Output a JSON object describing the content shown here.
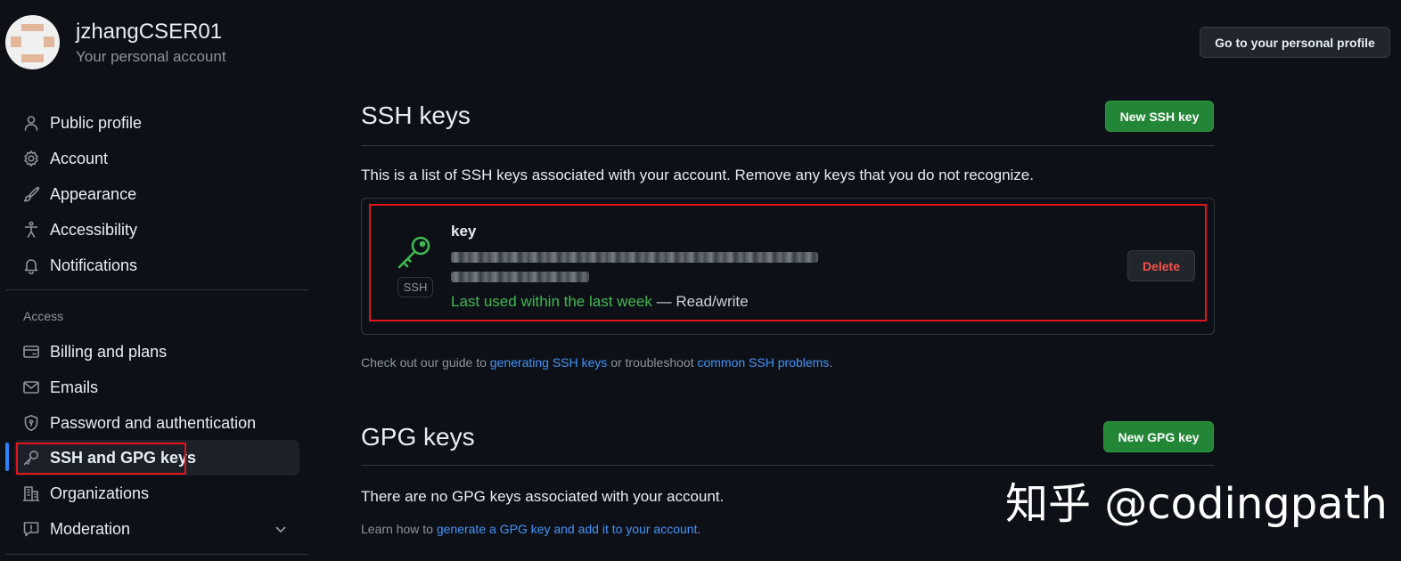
{
  "header": {
    "username": "jzhangCSER01",
    "account_type": "Your personal account",
    "profile_button": "Go to your personal profile"
  },
  "sidebar": {
    "items": [
      {
        "label": "Public profile",
        "icon": "person-icon"
      },
      {
        "label": "Account",
        "icon": "gear-icon"
      },
      {
        "label": "Appearance",
        "icon": "paintbrush-icon"
      },
      {
        "label": "Accessibility",
        "icon": "accessibility-icon"
      },
      {
        "label": "Notifications",
        "icon": "bell-icon"
      }
    ],
    "access_heading": "Access",
    "access_items": [
      {
        "label": "Billing and plans",
        "icon": "credit-card-icon"
      },
      {
        "label": "Emails",
        "icon": "mail-icon"
      },
      {
        "label": "Password and authentication",
        "icon": "shield-lock-icon"
      },
      {
        "label": "SSH and GPG keys",
        "icon": "key-icon",
        "active": true
      },
      {
        "label": "Organizations",
        "icon": "organization-icon"
      },
      {
        "label": "Moderation",
        "icon": "report-icon"
      }
    ]
  },
  "ssh": {
    "title": "SSH keys",
    "new_button": "New SSH key",
    "description": "This is a list of SSH keys associated with your account. Remove any keys that you do not recognize.",
    "keys": [
      {
        "name": "key",
        "badge": "SSH",
        "last_used": "Last used within the last week",
        "access": "— Read/write",
        "delete_label": "Delete"
      }
    ],
    "guide": {
      "prefix": "Check out our guide to",
      "link1": "generating SSH keys",
      "middle": "or troubleshoot",
      "link2": "common SSH problems",
      "suffix": "."
    }
  },
  "gpg": {
    "title": "GPG keys",
    "new_button": "New GPG key",
    "empty_text": "There are no GPG keys associated with your account.",
    "learn": {
      "prefix": "Learn how to",
      "link": "generate a GPG key and add it to your account",
      "suffix": "."
    }
  },
  "watermark": "知乎 @codingpath",
  "colors": {
    "background": "#0d1117",
    "green_button": "#238636",
    "link": "#4493f8",
    "danger": "#f85149",
    "highlight_outline": "#e3141a",
    "active_indicator": "#2f81f7"
  }
}
